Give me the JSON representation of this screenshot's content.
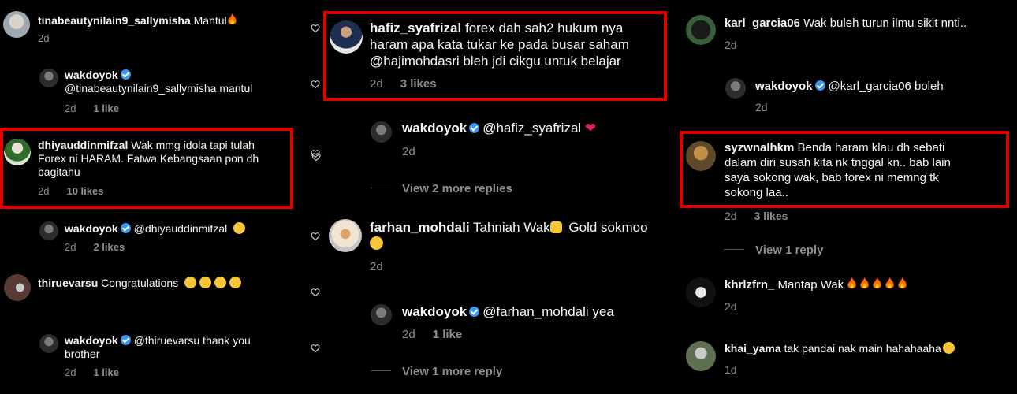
{
  "col1": {
    "comments": [
      {
        "username": "tinabeautynilain9_sallymisha",
        "text": "Mantul",
        "age": "2d",
        "likes": ""
      },
      {
        "username": "wakdoyok",
        "text": "@tinabeautynilain9_sallymisha mantul",
        "age": "2d",
        "likes": "1 like"
      },
      {
        "username": "dhiyauddinmifzal",
        "text_l1": "Wak mmg idola tapi tulah",
        "text_l2": "Forex ni HARAM.  Fatwa Kebangsaan pon dh",
        "text_l3": "bagitahu",
        "age": "2d",
        "likes": "10 likes"
      },
      {
        "username": "wakdoyok",
        "text": "@dhiyauddinmifzal",
        "age": "2d",
        "likes": "2 likes"
      },
      {
        "username": "thiruevarsu",
        "text": "Congratulations",
        "age": "",
        "likes": ""
      },
      {
        "username": "wakdoyok",
        "text_l1": "@thiruevarsu thank you",
        "text_l2": "brother",
        "age": "2d",
        "likes": "1 like"
      }
    ]
  },
  "col2": {
    "comments": [
      {
        "username": "hafiz_syafrizal",
        "text_l1": "forex dah sah2 hukum nya",
        "text_l2": "haram apa kata tukar ke pada busar saham",
        "text_l3": "@hajimohdasri bleh jdi cikgu untuk belajar",
        "age": "2d",
        "likes": "3 likes"
      },
      {
        "username": "wakdoyok",
        "text": "@hafiz_syafrizal",
        "age": "2d",
        "likes": ""
      },
      {
        "username": "farhan_mohdali",
        "text": "Tahniah Wak",
        "text_b": "Gold sokmoo",
        "age": "2d",
        "likes": ""
      },
      {
        "username": "wakdoyok",
        "text": "@farhan_mohdali yea",
        "age": "2d",
        "likes": "1 like"
      }
    ],
    "view_more_1": "View 2 more replies",
    "view_more_2": "View 1 more reply"
  },
  "col3": {
    "comments": [
      {
        "username": "karl_garcia06",
        "text": "Wak buleh turun ilmu sikit nnti..",
        "age": "2d",
        "likes": ""
      },
      {
        "username": "wakdoyok",
        "text": "@karl_garcia06 boleh",
        "age": "2d",
        "likes": ""
      },
      {
        "username": "syzwnalhkm",
        "text_l1": "Benda haram klau dh sebati",
        "text_l2": "dalam diri susah kita nk tnggal kn.. bab lain",
        "text_l3": "saya sokong wak, bab forex ni memng tk",
        "text_l4": "sokong laa..",
        "age": "2d",
        "likes": "3 likes"
      },
      {
        "username": "khrlzfrn_",
        "text": "Mantap Wak",
        "age": "2d",
        "likes": ""
      },
      {
        "username": "khai_yama",
        "text": "tak pandai nak main hahahaaha",
        "age": "1d",
        "likes": ""
      }
    ],
    "view_more": "View 1 reply"
  },
  "colors": {
    "background": "#000000",
    "text": "#f5f5f5",
    "meta": "#8e8e8e",
    "highlight": "#e00000",
    "verified": "#3897f0"
  },
  "icons": [
    "heart-outline-icon",
    "verified-badge-icon",
    "fire-emoji",
    "heart-eyes-emoji",
    "clapping-hands-emoji",
    "laughing-emoji",
    "red-heart-emoji"
  ]
}
